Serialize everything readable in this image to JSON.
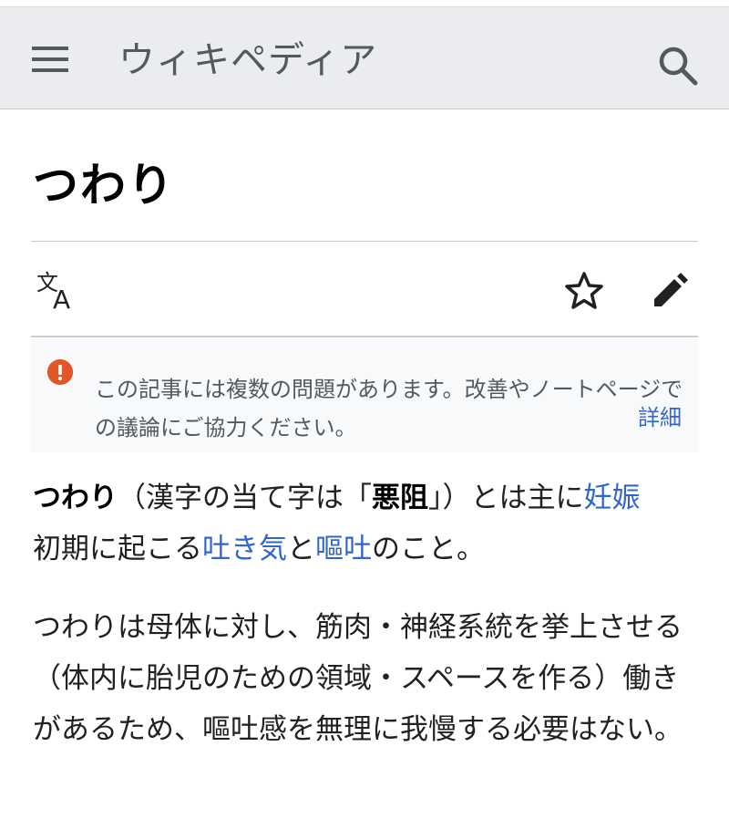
{
  "header": {
    "brand": "ウィキペディア",
    "menu_icon": "hamburger-menu-icon",
    "search_icon": "search-icon",
    "bg_color": "#eaecf0"
  },
  "article": {
    "title": "つわり"
  },
  "actions": {
    "language_icon": "translate-icon",
    "watch_icon": "star-icon",
    "edit_icon": "pencil-icon"
  },
  "notice": {
    "icon": "error-icon",
    "text": "この記事には複数の問題があります。改善やノートページでの議論にご協力ください。",
    "more_link": "詳細",
    "icon_color": "#dd3333"
  },
  "content": {
    "p1": {
      "term": "つわり",
      "t1": "（漢字の当て字は「",
      "bold2": "悪阻",
      "t2": "」）とは主に",
      "link1": "妊娠",
      "t3": "初期に起こる",
      "link2": "吐き気",
      "t4": "と",
      "link3": "嘔吐",
      "t5": "のこと。"
    },
    "p2": "つわりは母体に対し、筋肉・神経系統を挙上させる（体内に胎児のための領域・スペースを作る）働きがあるため、嘔吐感を無理に我慢する必要はない。"
  },
  "colors": {
    "link": "#3366cc",
    "text": "#202122"
  }
}
